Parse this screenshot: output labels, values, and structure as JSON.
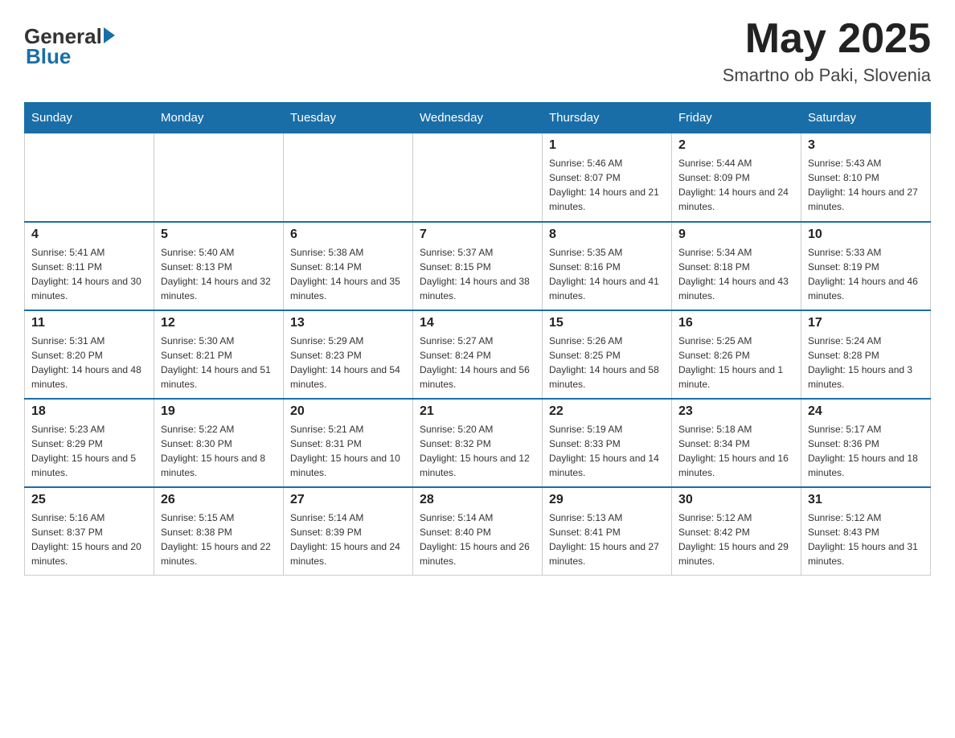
{
  "title": {
    "month": "May 2025",
    "location": "Smartno ob Paki, Slovenia"
  },
  "logo": {
    "general": "General",
    "blue": "Blue"
  },
  "days_of_week": [
    "Sunday",
    "Monday",
    "Tuesday",
    "Wednesday",
    "Thursday",
    "Friday",
    "Saturday"
  ],
  "weeks": [
    [
      {
        "day": "",
        "info": ""
      },
      {
        "day": "",
        "info": ""
      },
      {
        "day": "",
        "info": ""
      },
      {
        "day": "",
        "info": ""
      },
      {
        "day": "1",
        "info": "Sunrise: 5:46 AM\nSunset: 8:07 PM\nDaylight: 14 hours and 21 minutes."
      },
      {
        "day": "2",
        "info": "Sunrise: 5:44 AM\nSunset: 8:09 PM\nDaylight: 14 hours and 24 minutes."
      },
      {
        "day": "3",
        "info": "Sunrise: 5:43 AM\nSunset: 8:10 PM\nDaylight: 14 hours and 27 minutes."
      }
    ],
    [
      {
        "day": "4",
        "info": "Sunrise: 5:41 AM\nSunset: 8:11 PM\nDaylight: 14 hours and 30 minutes."
      },
      {
        "day": "5",
        "info": "Sunrise: 5:40 AM\nSunset: 8:13 PM\nDaylight: 14 hours and 32 minutes."
      },
      {
        "day": "6",
        "info": "Sunrise: 5:38 AM\nSunset: 8:14 PM\nDaylight: 14 hours and 35 minutes."
      },
      {
        "day": "7",
        "info": "Sunrise: 5:37 AM\nSunset: 8:15 PM\nDaylight: 14 hours and 38 minutes."
      },
      {
        "day": "8",
        "info": "Sunrise: 5:35 AM\nSunset: 8:16 PM\nDaylight: 14 hours and 41 minutes."
      },
      {
        "day": "9",
        "info": "Sunrise: 5:34 AM\nSunset: 8:18 PM\nDaylight: 14 hours and 43 minutes."
      },
      {
        "day": "10",
        "info": "Sunrise: 5:33 AM\nSunset: 8:19 PM\nDaylight: 14 hours and 46 minutes."
      }
    ],
    [
      {
        "day": "11",
        "info": "Sunrise: 5:31 AM\nSunset: 8:20 PM\nDaylight: 14 hours and 48 minutes."
      },
      {
        "day": "12",
        "info": "Sunrise: 5:30 AM\nSunset: 8:21 PM\nDaylight: 14 hours and 51 minutes."
      },
      {
        "day": "13",
        "info": "Sunrise: 5:29 AM\nSunset: 8:23 PM\nDaylight: 14 hours and 54 minutes."
      },
      {
        "day": "14",
        "info": "Sunrise: 5:27 AM\nSunset: 8:24 PM\nDaylight: 14 hours and 56 minutes."
      },
      {
        "day": "15",
        "info": "Sunrise: 5:26 AM\nSunset: 8:25 PM\nDaylight: 14 hours and 58 minutes."
      },
      {
        "day": "16",
        "info": "Sunrise: 5:25 AM\nSunset: 8:26 PM\nDaylight: 15 hours and 1 minute."
      },
      {
        "day": "17",
        "info": "Sunrise: 5:24 AM\nSunset: 8:28 PM\nDaylight: 15 hours and 3 minutes."
      }
    ],
    [
      {
        "day": "18",
        "info": "Sunrise: 5:23 AM\nSunset: 8:29 PM\nDaylight: 15 hours and 5 minutes."
      },
      {
        "day": "19",
        "info": "Sunrise: 5:22 AM\nSunset: 8:30 PM\nDaylight: 15 hours and 8 minutes."
      },
      {
        "day": "20",
        "info": "Sunrise: 5:21 AM\nSunset: 8:31 PM\nDaylight: 15 hours and 10 minutes."
      },
      {
        "day": "21",
        "info": "Sunrise: 5:20 AM\nSunset: 8:32 PM\nDaylight: 15 hours and 12 minutes."
      },
      {
        "day": "22",
        "info": "Sunrise: 5:19 AM\nSunset: 8:33 PM\nDaylight: 15 hours and 14 minutes."
      },
      {
        "day": "23",
        "info": "Sunrise: 5:18 AM\nSunset: 8:34 PM\nDaylight: 15 hours and 16 minutes."
      },
      {
        "day": "24",
        "info": "Sunrise: 5:17 AM\nSunset: 8:36 PM\nDaylight: 15 hours and 18 minutes."
      }
    ],
    [
      {
        "day": "25",
        "info": "Sunrise: 5:16 AM\nSunset: 8:37 PM\nDaylight: 15 hours and 20 minutes."
      },
      {
        "day": "26",
        "info": "Sunrise: 5:15 AM\nSunset: 8:38 PM\nDaylight: 15 hours and 22 minutes."
      },
      {
        "day": "27",
        "info": "Sunrise: 5:14 AM\nSunset: 8:39 PM\nDaylight: 15 hours and 24 minutes."
      },
      {
        "day": "28",
        "info": "Sunrise: 5:14 AM\nSunset: 8:40 PM\nDaylight: 15 hours and 26 minutes."
      },
      {
        "day": "29",
        "info": "Sunrise: 5:13 AM\nSunset: 8:41 PM\nDaylight: 15 hours and 27 minutes."
      },
      {
        "day": "30",
        "info": "Sunrise: 5:12 AM\nSunset: 8:42 PM\nDaylight: 15 hours and 29 minutes."
      },
      {
        "day": "31",
        "info": "Sunrise: 5:12 AM\nSunset: 8:43 PM\nDaylight: 15 hours and 31 minutes."
      }
    ]
  ]
}
